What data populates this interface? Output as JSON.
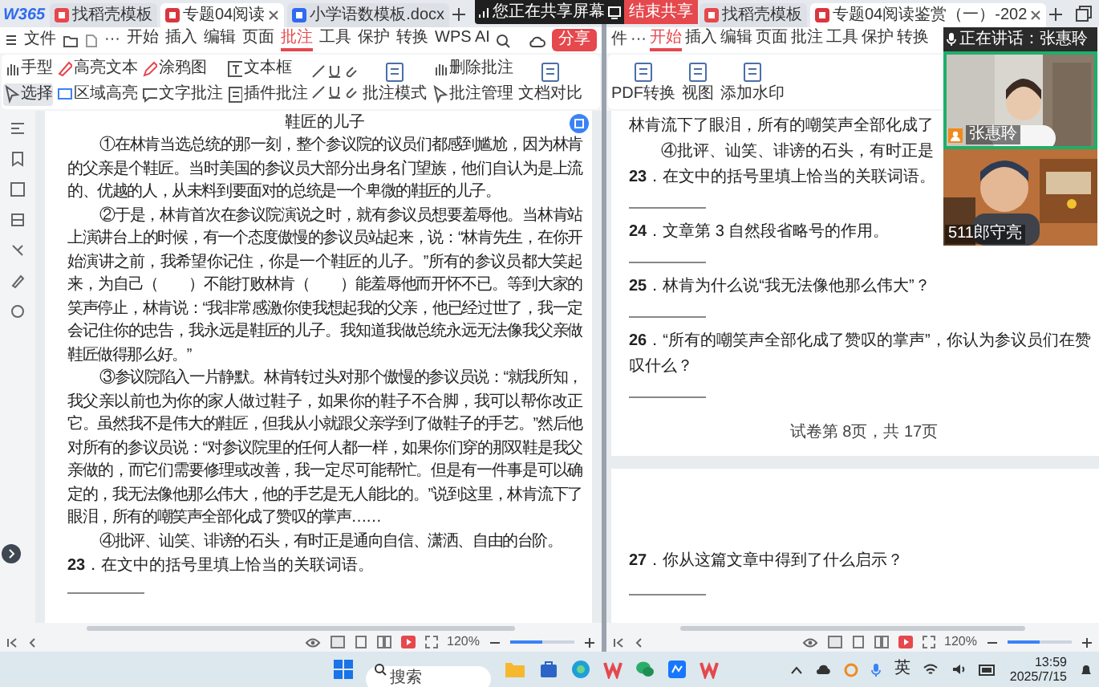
{
  "share_bar": {
    "message": "您正在共享屏幕",
    "button": "结束共享"
  },
  "left_window": {
    "logo": "W365",
    "tabs": [
      {
        "label": "找稻壳模板",
        "kind": "template",
        "selected": false
      },
      {
        "label": "专题04阅读",
        "kind": "pdf",
        "selected": true
      },
      {
        "label": "小学语数模板.docx",
        "kind": "doc",
        "selected": false
      }
    ],
    "file_menu": "文件",
    "more": "···",
    "menu": [
      {
        "label": "开始",
        "selected": false
      },
      {
        "label": "插入",
        "selected": false
      },
      {
        "label": "编辑",
        "selected": false
      },
      {
        "label": "页面",
        "selected": false
      },
      {
        "label": "批注",
        "selected": true
      },
      {
        "label": "工具",
        "selected": false
      },
      {
        "label": "保护",
        "selected": false
      },
      {
        "label": "转换",
        "selected": false
      },
      {
        "label": "WPS AI",
        "selected": false
      }
    ],
    "share_button": "分享",
    "ribbon": [
      {
        "kind": "small",
        "items": [
          {
            "label": "手型",
            "selected": false
          },
          {
            "label": "选择",
            "selected": true
          }
        ]
      },
      {
        "kind": "small",
        "items": [
          {
            "label": "高亮文本"
          },
          {
            "label": "区域高亮"
          }
        ]
      },
      {
        "kind": "small",
        "items": [
          {
            "label": "涂鸦图"
          },
          {
            "label": "文字批注"
          }
        ]
      },
      {
        "kind": "small",
        "items": [
          {
            "label": "文本框"
          },
          {
            "label": "插件批注"
          }
        ]
      },
      {
        "kind": "tools"
      },
      {
        "kind": "large",
        "items": [
          {
            "label": "批注模式"
          }
        ]
      },
      {
        "kind": "small",
        "items": [
          {
            "label": "删除批注"
          },
          {
            "label": "批注管理"
          }
        ]
      },
      {
        "kind": "large",
        "items": [
          {
            "label": "文档对比"
          }
        ]
      }
    ],
    "document": {
      "title": "鞋匠的儿子",
      "paragraphs": [
        "①在林肯当选总统的那一刻，整个参议院的议员们都感到尴尬，因为林肯的父亲是个鞋匠。当时美国的参议员大部分出身名门望族，他们自认为是上流的、优越的人，从未料到要面对的总统是一个卑微的鞋匠的儿子。",
        "②于是，林肯首次在参议院演说之时，就有参议员想要羞辱他。当林肯站上演讲台上的时候，有一个态度傲慢的参议员站起来，说：“林肯先生，在你开始演讲之前，我希望你记住，你是一个鞋匠的儿子。”所有的参议员都大笑起来，为自己（　　）不能打败林肯（　　）能羞辱他而开怀不已。等到大家的笑声停止，林肯说：“我非常感激你使我想起我的父亲，他已经过世了，我一定会记住你的忠告，我永远是鞋匠的儿子。我知道我做总统永远无法像我父亲做鞋匠做得那么好。”",
        "③参议院陷入一片静默。林肯转过头对那个傲慢的参议员说：“就我所知，我父亲以前也为你的家人做过鞋子，如果你的鞋子不合脚，我可以帮你改正它。虽然我不是伟大的鞋匠，但我从小就跟父亲学到了做鞋子的手艺。”然后他对所有的参议员说：“对参议院里的任何人都一样，如果你们穿的那双鞋是我父亲做的，而它们需要修理或改善，我一定尽可能帮忙。但是有一件事是可以确定的，我无法像他那么伟大，他的手艺是无人能比的。”说到这里，林肯流下了眼泪，所有的嘲笑声全部化成了赞叹的掌声……",
        "④批评、讪笑、诽谤的石头，有时正是通向自信、潇洒、自由的台阶。"
      ],
      "questions": [
        "**23**．在文中的括号里填上恰当的关联词语。"
      ]
    },
    "zoom": {
      "reading": "120%",
      "level": 0.5
    }
  },
  "right_window": {
    "tabs": [
      {
        "label": "找稻壳模板",
        "kind": "template",
        "selected": false
      },
      {
        "label": "专题04阅读鉴赏（一）-202",
        "kind": "pdf",
        "selected": true
      }
    ],
    "file_menu": "件",
    "more": "···",
    "menu": [
      {
        "label": "开始",
        "selected": true
      },
      {
        "label": "插入",
        "selected": false
      },
      {
        "label": "编辑",
        "selected": false
      },
      {
        "label": "页面",
        "selected": false
      },
      {
        "label": "批注",
        "selected": false
      },
      {
        "label": "工具",
        "selected": false
      },
      {
        "label": "保护",
        "selected": false
      },
      {
        "label": "转换",
        "selected": false
      }
    ],
    "ribbon": [
      {
        "kind": "large",
        "items": [
          {
            "label": "PDF转换"
          }
        ]
      },
      {
        "kind": "large",
        "items": [
          {
            "label": "视图"
          }
        ]
      },
      {
        "kind": "large",
        "items": [
          {
            "label": "添加水印"
          }
        ]
      }
    ],
    "document": {
      "lines": [
        "林肯流下了眼泪，所有的嘲笑声全部化成了",
        "④批评、讪笑、诽谤的石头，有时正是"
      ],
      "questions": [
        "**23**．在文中的括号里填上恰当的关联词语。",
        "**24**．文章第 3 自然段省略号的作用。",
        "**25**．林肯为什么说“我无法像他那么伟大”？",
        "**26**．“所有的嘲笑声全部化成了赞叹的掌声”，你认为参议员们在赞叹什么？"
      ],
      "footer": "试卷第 8页，共 17页",
      "next_page_questions": [
        "**27**．你从这篇文章中得到了什么启示？"
      ]
    },
    "zoom": {
      "reading": "120%",
      "level": 0.5
    }
  },
  "video_panel": {
    "speaking": "正在讲话：张惠聆",
    "tiles": [
      {
        "name": "张惠聆",
        "kind": "picture"
      },
      {
        "name": "511郎守亮",
        "kind": "picture"
      }
    ]
  },
  "taskbar": {
    "search_placeholder": "搜索",
    "input_indicator": "英",
    "time": "13:59",
    "date": "2025/7/15"
  }
}
